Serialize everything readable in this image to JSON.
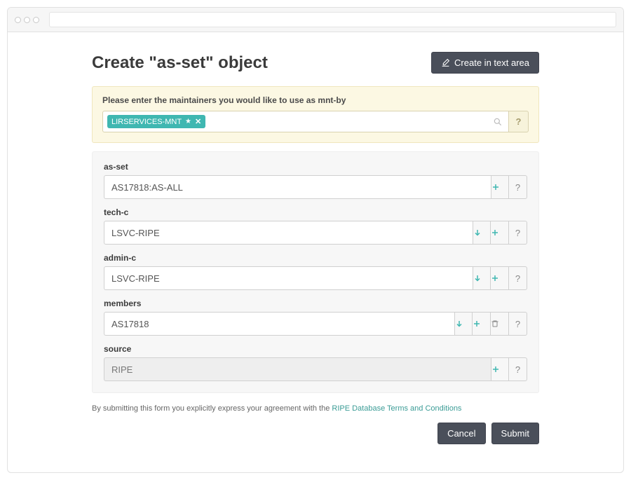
{
  "header": {
    "title": "Create \"as-set\" object",
    "create_text_area": "Create in text area"
  },
  "mnt": {
    "label": "Please enter the maintainers you would like to use as mnt-by",
    "tag_label": "LIRSERVICES-MNT"
  },
  "fields": {
    "as_set": {
      "label": "as-set",
      "value": "AS17818:AS-ALL"
    },
    "tech_c": {
      "label": "tech-c",
      "value": "LSVC-RIPE"
    },
    "admin_c": {
      "label": "admin-c",
      "value": "LSVC-RIPE"
    },
    "members": {
      "label": "members",
      "value": "AS17818"
    },
    "source": {
      "label": "source",
      "value": "RIPE"
    }
  },
  "agreement": {
    "prefix": "By submitting this form you explicitly express your agreement with the ",
    "link": "RIPE Database Terms and Conditions"
  },
  "actions": {
    "cancel": "Cancel",
    "submit": "Submit"
  }
}
